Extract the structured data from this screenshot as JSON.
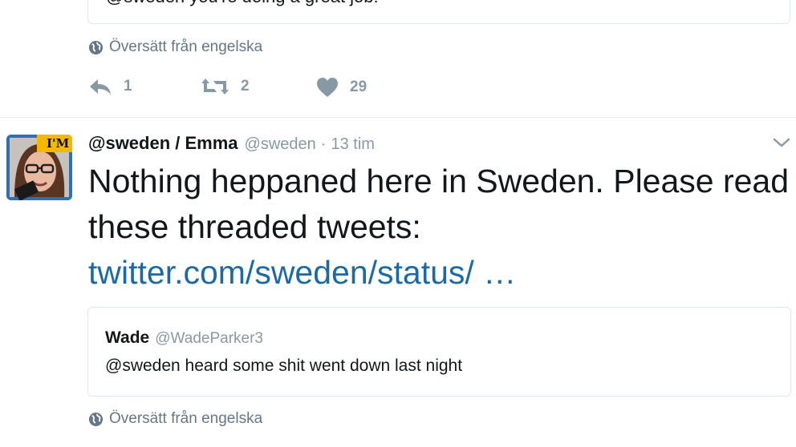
{
  "previous_tweet": {
    "quote_text": "@sweden you're doing a great job!",
    "translate_label": "Översätt från engelska",
    "actions": {
      "reply_count": "1",
      "retweet_count": "2",
      "like_count": "29"
    }
  },
  "tweet": {
    "author_name": "@sweden / Emma",
    "author_handle": "@sweden",
    "separator": "·",
    "timestamp": "13 tim",
    "avatar_badge": "I'M",
    "text": "Nothing heppaned here in Sweden. Please read these threaded tweets:",
    "link": "twitter.com/sweden/status/ …",
    "quoted": {
      "name": "Wade",
      "handle": "@WadeParker3",
      "text": "@sweden heard some shit went down last night"
    },
    "translate_label": "Översätt från engelska"
  },
  "colors": {
    "link": "#1b6aa5",
    "muted": "#8899a6",
    "border": "#e1e8ed"
  }
}
